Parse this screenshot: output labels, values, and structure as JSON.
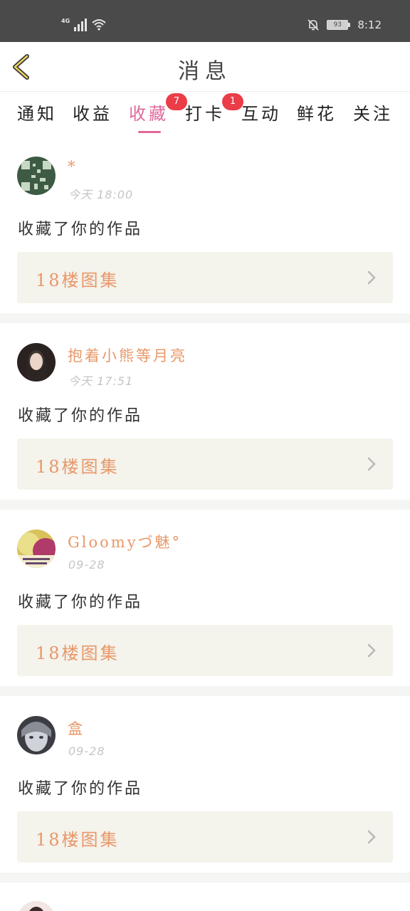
{
  "status_bar": {
    "network": "4G",
    "battery": "93",
    "time": "8:12"
  },
  "header": {
    "title": "消息"
  },
  "tabs": [
    {
      "label": "通知",
      "badge": ""
    },
    {
      "label": "收益",
      "badge": ""
    },
    {
      "label": "收藏",
      "badge": "7",
      "active": true
    },
    {
      "label": "打卡",
      "badge": "1"
    },
    {
      "label": "互动",
      "badge": ""
    },
    {
      "label": "鲜花",
      "badge": ""
    },
    {
      "label": "关注",
      "badge": ""
    }
  ],
  "colors": {
    "accent": "#e0689b",
    "name": "#e8986a",
    "badge": "#ea3d48",
    "card_box": "#f4f3ec"
  },
  "feed": [
    {
      "username": "*",
      "timestamp": "今天 18:00",
      "action": "收藏了你的作品",
      "work": "18楼图集"
    },
    {
      "username": "抱着小熊等月亮",
      "timestamp": "今天 17:51",
      "action": "收藏了你的作品",
      "work": "18楼图集"
    },
    {
      "username": "Gloomyづ魅°",
      "timestamp": "09-28",
      "action": "收藏了你的作品",
      "work": "18楼图集"
    },
    {
      "username": "盒",
      "timestamp": "09-28",
      "action": "收藏了你的作品",
      "work": "18楼图集"
    }
  ]
}
